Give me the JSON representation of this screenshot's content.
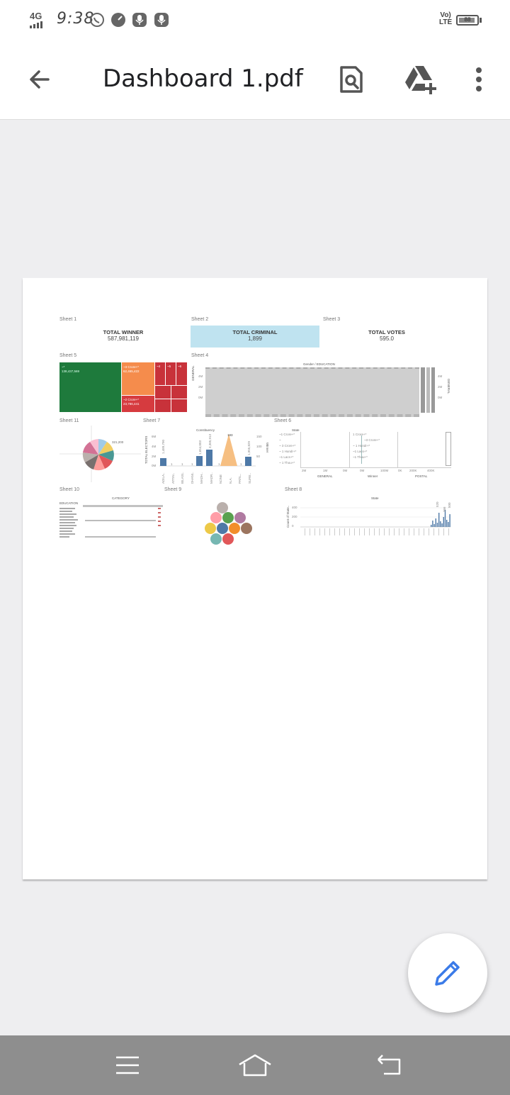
{
  "status_bar": {
    "network": "4G",
    "time": "9:38",
    "volte": "Vo)",
    "lte": "LTE",
    "battery_level": "88",
    "icons": [
      "whatsapp-icon",
      "speedometer-icon",
      "mic-icon",
      "mic-icon"
    ]
  },
  "app_bar": {
    "back_icon": "arrow-back-icon",
    "title": "Dashboard 1.pdf",
    "search_icon": "document-search-icon",
    "drive_icon": "drive-add-icon",
    "more_icon": "more-vert-icon"
  },
  "dashboard": {
    "sheet1": {
      "label": "Sheet 1",
      "kpi_title": "TOTAL WINNER",
      "kpi_value": "587,981,119"
    },
    "sheet2": {
      "label": "Sheet 2",
      "kpi_title": "TOTAL CRIMINAL",
      "kpi_value": "1,899"
    },
    "sheet3": {
      "label": "Sheet 3",
      "kpi_title": "TOTAL VOTES",
      "kpi_value": "595.0"
    },
    "sheet5": {
      "label": "Sheet 5",
      "block_a_title": "~*",
      "block_a_value": "138,437,569",
      "block_b_title": "~3 Crore+*",
      "block_b_value": "62,465,422",
      "block_c_title": "~2 Crore+*",
      "block_c_value": "23,786,441",
      "small_labels": [
        "~4",
        "~5",
        "~6"
      ]
    },
    "sheet4": {
      "label": "Sheet 4",
      "header": "Gender / EDUCATION",
      "axis_label": "GENERAL",
      "ticks": [
        "4M",
        "2M",
        "0M"
      ]
    },
    "sheet11": {
      "label": "Sheet 11",
      "value_label": "321,200"
    },
    "sheet7": {
      "label": "Sheet 7",
      "header": "Constituency",
      "ylabel": "TOTAL ELECTORS",
      "y2label": "Winner",
      "ticks": [
        "6M",
        "4M",
        "2M",
        "0M"
      ],
      "ticks_right": [
        "150",
        "100",
        "50"
      ],
      "peak_label": "183",
      "categories": [
        "ADILA..",
        "ATTIN..",
        "BILASI..",
        "DHANI..",
        "MADH..",
        "MADR..",
        "NONE",
        "N.A.",
        "PATIL..",
        "SURE.."
      ],
      "value_labels": [
        "1,489,790",
        "1",
        "1",
        "1",
        "1,654,003",
        "3,365,913",
        "1",
        "1",
        "1",
        "1,955,829"
      ]
    },
    "sheet6": {
      "label": "Sheet 6",
      "header": "State",
      "rows": [
        "~1 Crore+*",
        "~",
        "~ 3 Crore+*",
        "~ 1 Hundr+*",
        "~1 Lacs+*",
        "~ 1 Thou+*"
      ],
      "mid_rows": [
        "1 Crore+*",
        "~3 Crore+*",
        "~ 1 Hundr+*",
        "~1 Lacs+*",
        "~1 Thou+*"
      ],
      "panels": [
        "GENERAL",
        "Winner",
        "POSTAL"
      ],
      "ticks_a": [
        "2M",
        "1M",
        "0M"
      ],
      "ticks_b": [
        "0M",
        "100M"
      ],
      "ticks_c": [
        "0K",
        "200K",
        "400K"
      ]
    },
    "sheet10": {
      "label": "Sheet 10",
      "header": "CATEGORY",
      "row_header": "EDUCATION"
    },
    "sheet9": {
      "label": "Sheet 9",
      "circle_colors": [
        "#bab0ac",
        "#ff9da7",
        "#59a14f",
        "#b07aa1",
        "#edc948",
        "#4e79a7",
        "#f28e2b",
        "#9c755f",
        "#76b7b2",
        "#e15759"
      ]
    },
    "sheet8": {
      "label": "Sheet 8",
      "header": "State",
      "ylabel": "Count of State..",
      "ticks": [
        "400",
        "200",
        "0"
      ],
      "labels": [
        "520",
        "366",
        "500"
      ]
    }
  },
  "fab": {
    "icon": "pencil-edit-icon"
  },
  "nav_bar": {
    "icons": [
      "menu-icon",
      "home-icon",
      "back-return-icon"
    ]
  }
}
